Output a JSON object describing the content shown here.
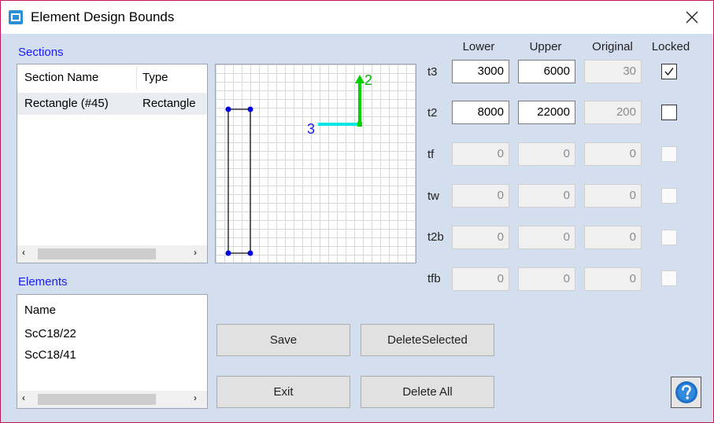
{
  "window": {
    "title": "Element Design Bounds",
    "accent_color": "#c2185b",
    "background_color": "#d3deee"
  },
  "sections": {
    "label": "Sections",
    "columns": [
      "Section Name",
      "Type"
    ],
    "rows": [
      {
        "name": "Rectangle (#45)",
        "type": "Rectangle"
      }
    ]
  },
  "elements": {
    "label": "Elements",
    "column": "Name",
    "items": [
      "ScC18/22",
      "ScC18/41"
    ]
  },
  "preview": {
    "axis_vertical_label": "2",
    "axis_horizontal_label": "3",
    "axis_vertical_color": "#00d200",
    "axis_horizontal_color": "#00e5e5"
  },
  "bounds": {
    "headers": {
      "lower": "Lower",
      "upper": "Upper",
      "original": "Original",
      "locked": "Locked"
    },
    "rows": [
      {
        "label": "t3",
        "lower": "3000",
        "upper": "6000",
        "original": "30",
        "locked": true,
        "enabled": true
      },
      {
        "label": "t2",
        "lower": "8000",
        "upper": "22000",
        "original": "200",
        "locked": false,
        "enabled": true
      },
      {
        "label": "tf",
        "lower": "0",
        "upper": "0",
        "original": "0",
        "locked": false,
        "enabled": false
      },
      {
        "label": "tw",
        "lower": "0",
        "upper": "0",
        "original": "0",
        "locked": false,
        "enabled": false
      },
      {
        "label": "t2b",
        "lower": "0",
        "upper": "0",
        "original": "0",
        "locked": false,
        "enabled": false
      },
      {
        "label": "tfb",
        "lower": "0",
        "upper": "0",
        "original": "0",
        "locked": false,
        "enabled": false
      }
    ]
  },
  "buttons": {
    "save": "Save",
    "delete_selected": "DeleteSelected",
    "exit": "Exit",
    "delete_all": "Delete All"
  },
  "icons": {
    "app": "app-icon",
    "close": "close-icon",
    "help": "help-icon",
    "checkmark": "checkmark-icon",
    "scroll_left": "‹",
    "scroll_right": "›"
  }
}
